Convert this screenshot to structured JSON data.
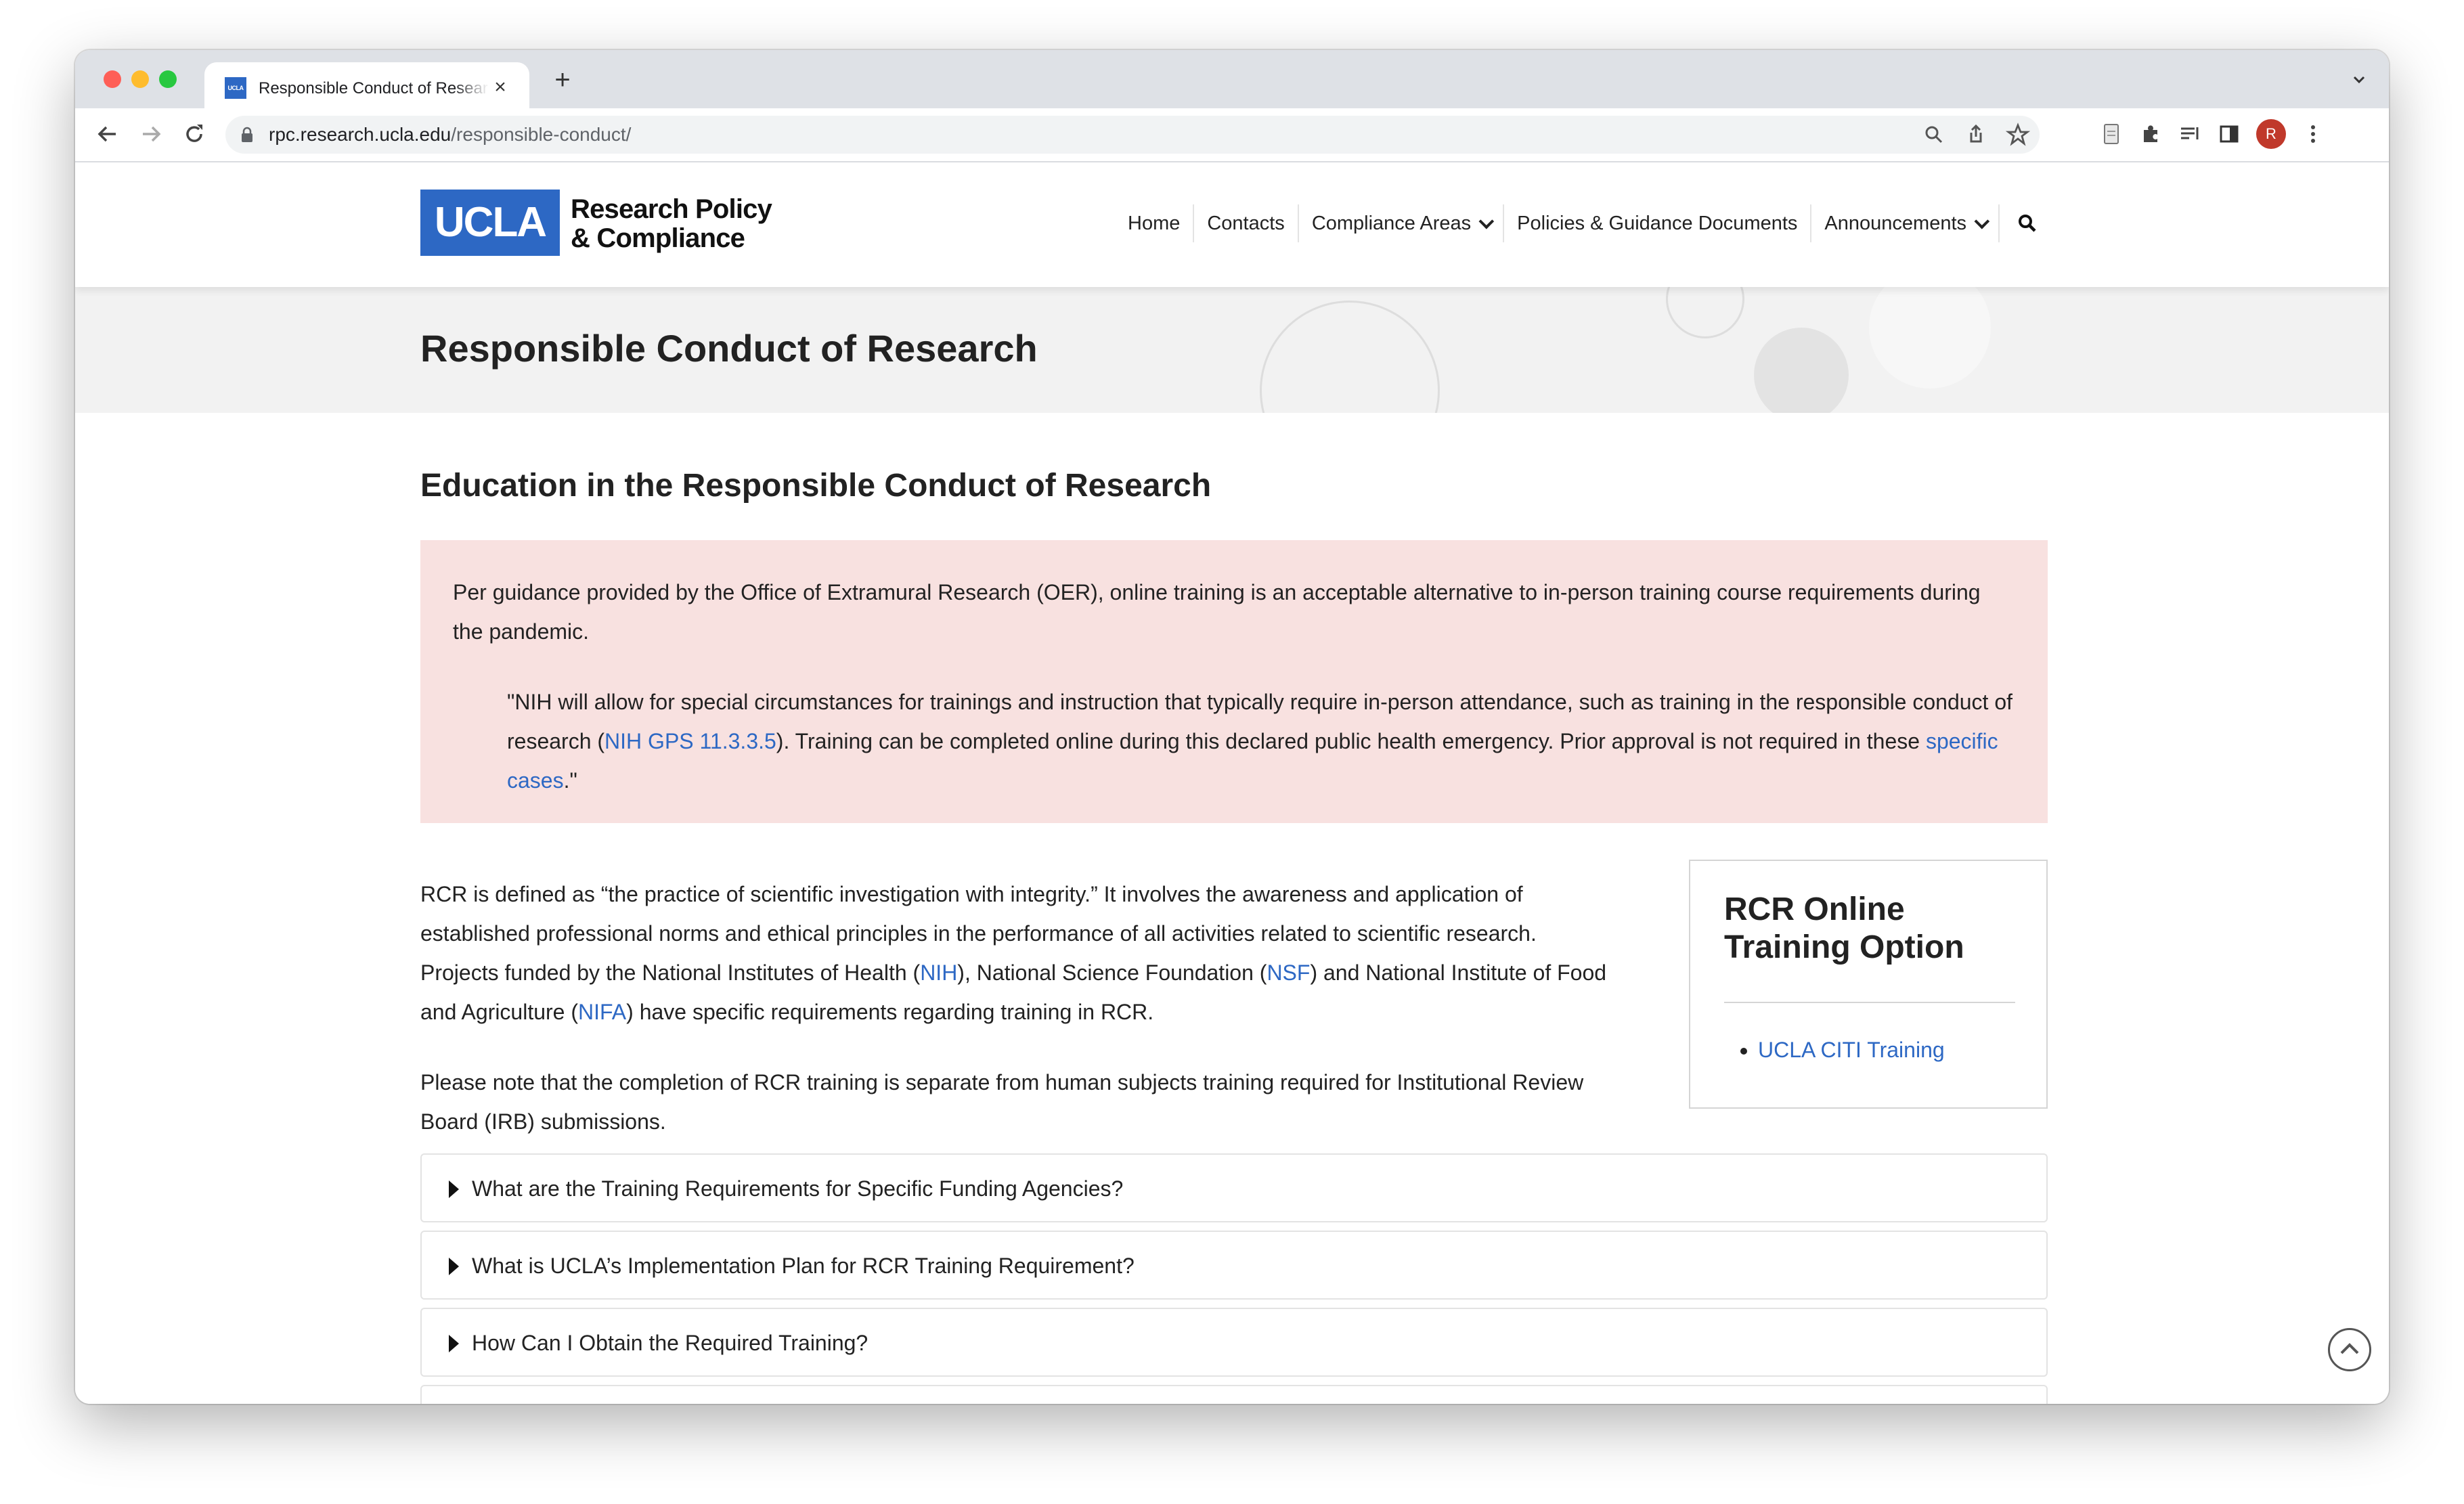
{
  "browser": {
    "tab_title": "Responsible Conduct of Research – Research Policy & Compliance",
    "tab_favicon_text": "UCLA",
    "url_domain": "rpc.research.ucla.edu",
    "url_path": "/responsible-conduct/",
    "avatar_initial": "R"
  },
  "site": {
    "logo_mark": "UCLA",
    "logo_line1": "Research Policy",
    "logo_line2": "& Compliance",
    "nav": [
      "Home",
      "Contacts",
      "Compliance Areas",
      "Policies & Guidance Documents",
      "Announcements"
    ],
    "accent_color": "#2d68c4"
  },
  "page": {
    "title": "Responsible Conduct of Research",
    "section_heading": "Education in the Responsible Conduct of Research",
    "alert": {
      "intro": "Per guidance provided by the Office of Extramural Research (OER), online training is an acceptable alternative to in-person training course requirements during the pandemic.",
      "quote_part1": "\"NIH will allow for special circumstances for trainings and instruction that typically require in-person attendance, such as training in the responsible conduct of research (",
      "quote_link1": "NIH GPS 11.3.3.5",
      "quote_part2": "). Training can be completed online during this declared public health emergency. Prior approval is not required in these ",
      "quote_link2": "specific cases",
      "quote_part3": ".\""
    },
    "para1": {
      "text1": "RCR is defined as “the practice of scientific investigation with integrity.” It involves the awareness and application of established professional norms and ethical principles in the performance of all activities related to scientific research. Projects funded by the National Institutes of Health (",
      "link_nih": "NIH",
      "text2": "), National Science Foundation (",
      "link_nsf": "NSF",
      "text3": ") and National Institute of Food and Agriculture (",
      "link_nifa": "NIFA",
      "text4": ") have specific requirements regarding training in RCR."
    },
    "para2": "Please note that the completion of RCR training is separate from human subjects training required for Institutional Review Board (IRB) submissions.",
    "sidebar": {
      "title": "RCR Online Training Option",
      "link": "UCLA CITI Training"
    },
    "accordions": [
      "What are the Training Requirements for Specific Funding Agencies?",
      "What is UCLA’s Implementation Plan for RCR Training Requirement?",
      "How Can I Obtain the Required Training?"
    ]
  }
}
